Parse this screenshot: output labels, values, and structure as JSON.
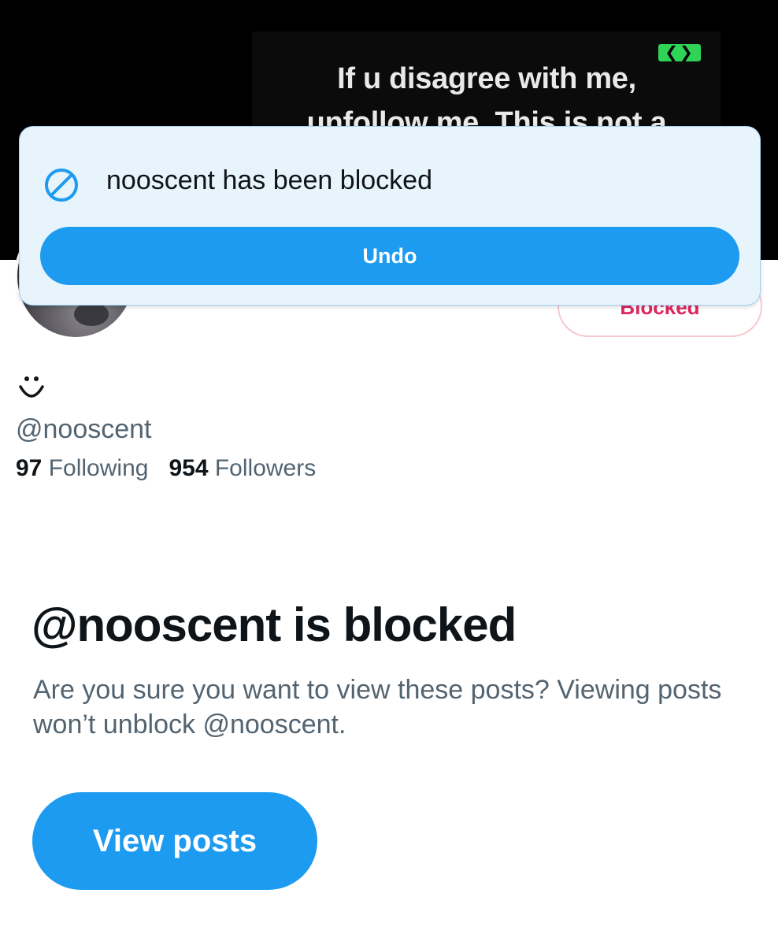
{
  "banner": {
    "text": "If u disagree with me,\nunfollow me. This is not a",
    "quote_glyph": "❮❯",
    "accent": "#2fd356"
  },
  "profile": {
    "display_name_emoji": "smiley-face-icon",
    "handle": "@nooscent",
    "following_count": "97",
    "following_label": "Following",
    "followers_count": "954",
    "followers_label": "Followers",
    "blocked_button": "Blocked"
  },
  "toast": {
    "icon": "block-icon",
    "message": "nooscent has been blocked",
    "undo_label": "Undo"
  },
  "notice": {
    "title": "@nooscent is blocked",
    "description": "Are you sure you want to view these posts? Viewing posts won’t unblock @nooscent.",
    "view_posts_label": "View posts"
  },
  "colors": {
    "primary": "#1d9bf0",
    "danger": "#e0245e",
    "secondary_text": "#536471",
    "toast_bg": "#e8f4fc"
  }
}
